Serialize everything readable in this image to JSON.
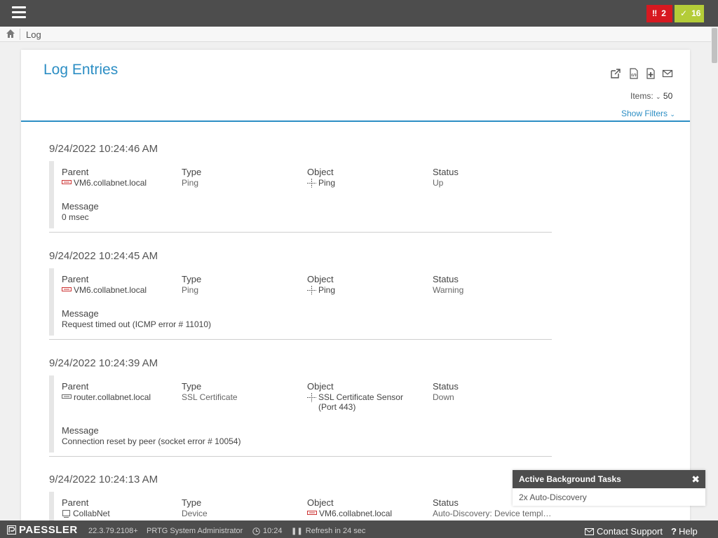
{
  "header": {
    "menu_icon": "hamburger-icon",
    "alarms_down": "2",
    "alarms_up": "16",
    "colors": {
      "down": "#d71920",
      "up": "#b4cc38",
      "bar": "#4d4d4d"
    }
  },
  "breadcrumb": {
    "home_icon": "home-icon",
    "label": "Log"
  },
  "page": {
    "title": "Log Entries",
    "tools": [
      "external-link-icon",
      "xml-icon",
      "csv-icon",
      "email-icon"
    ],
    "items_label": "Items:",
    "items_value": "50",
    "show_filters": "Show Filters",
    "accent": "#2c8ec4"
  },
  "labels": {
    "parent": "Parent",
    "type": "Type",
    "object": "Object",
    "status": "Status",
    "message": "Message"
  },
  "entries": [
    {
      "time": "9/24/2022 10:24:46 AM",
      "parent": "VM6.collabnet.local",
      "type": "Ping",
      "object": "Ping",
      "status": "Up",
      "message": "0 msec"
    },
    {
      "time": "9/24/2022 10:24:45 AM",
      "parent": "VM6.collabnet.local",
      "type": "Ping",
      "object": "Ping",
      "status": "Warning",
      "message": "Request timed out (ICMP error # 11010)"
    },
    {
      "time": "9/24/2022 10:24:39 AM",
      "parent": "router.collabnet.local",
      "type": "SSL Certificate",
      "object": "SSL Certificate Sensor (Port 443)",
      "status": "Down",
      "message": "Connection reset by peer (socket error # 10054)"
    },
    {
      "time": "9/24/2022 10:24:13 AM",
      "parent": "CollabNet",
      "type": "Device",
      "object": "VM6.collabnet.local",
      "status": "Auto-Discovery: Device templ…",
      "message": ""
    }
  ],
  "tasks": {
    "title": "Active Background Tasks",
    "item": "2x Auto-Discovery"
  },
  "footer": {
    "brand": "PAESSLER",
    "version": "22.3.79.2108+",
    "user": "PRTG System Administrator",
    "time": "10:24",
    "refresh": "Refresh in 24 sec",
    "contact": "Contact Support",
    "help": "Help"
  }
}
